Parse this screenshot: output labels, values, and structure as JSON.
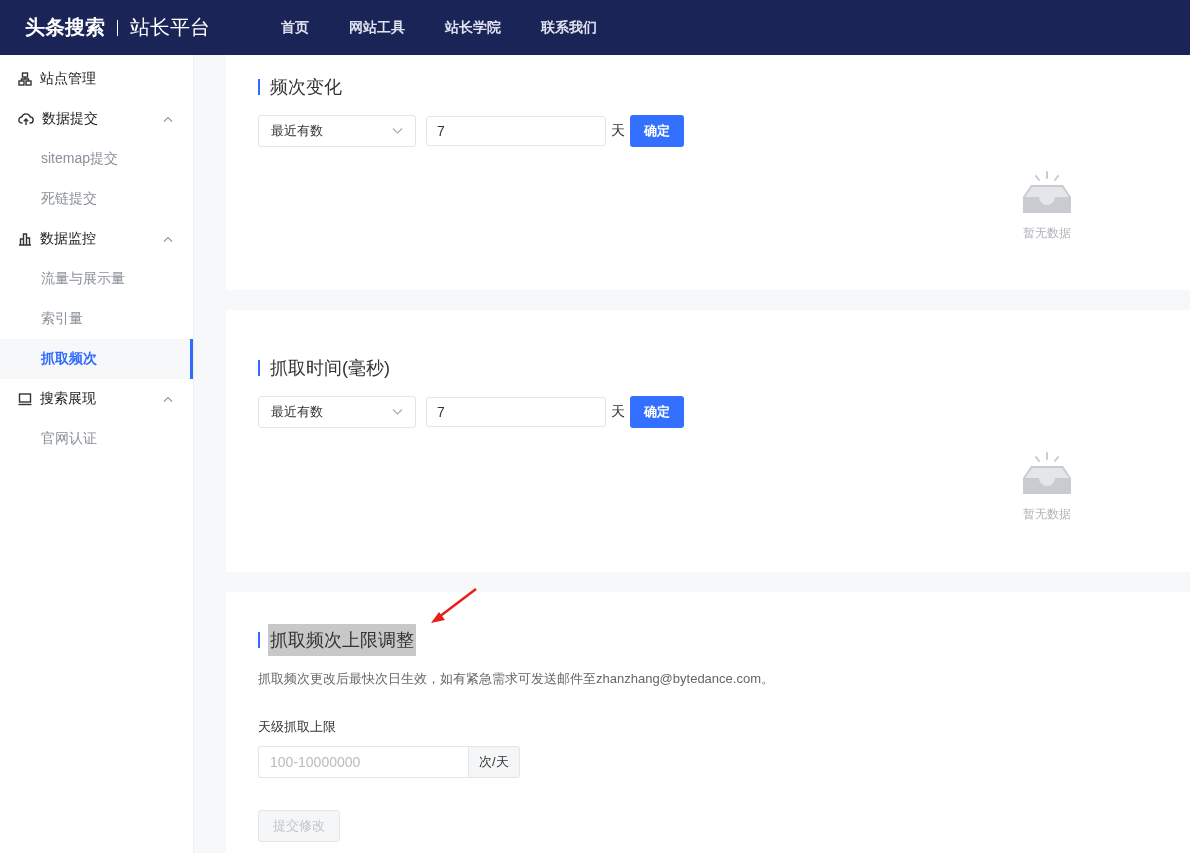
{
  "header": {
    "brand": "头条搜索",
    "product": "站长平台",
    "nav": [
      {
        "label": "首页"
      },
      {
        "label": "网站工具"
      },
      {
        "label": "站长学院"
      },
      {
        "label": "联系我们"
      }
    ]
  },
  "sidebar": {
    "items": [
      {
        "label": "站点管理"
      },
      {
        "label": "数据提交",
        "expanded": true,
        "children": [
          {
            "label": "sitemap提交",
            "selected": false
          },
          {
            "label": "死链提交",
            "selected": false
          }
        ]
      },
      {
        "label": "数据监控",
        "expanded": true,
        "children": [
          {
            "label": "流量与展示量",
            "selected": false
          },
          {
            "label": "索引量",
            "selected": false
          },
          {
            "label": "抓取频次",
            "selected": true
          }
        ]
      },
      {
        "label": "搜索展现",
        "expanded": true,
        "children": [
          {
            "label": "官网认证",
            "selected": false
          }
        ]
      }
    ]
  },
  "cards": [
    {
      "kind": "filter",
      "title": "频次变化",
      "select": "最近有数",
      "days": "7",
      "unit": "天",
      "button": "确定",
      "empty": "暂无数据"
    },
    {
      "kind": "filter",
      "title": "抓取时间(毫秒)",
      "select": "最近有数",
      "days": "7",
      "unit": "天",
      "button": "确定",
      "empty": "暂无数据"
    },
    {
      "kind": "limit",
      "title": "抓取频次上限调整",
      "highlighted": true,
      "note": "抓取频次更改后最快次日生效，如有紧急需求可发送邮件至zhanzhang@bytedance.com。",
      "field_label": "天级抓取上限",
      "placeholder": "100-10000000",
      "addon": "次/天",
      "submit": "提交修改",
      "submit_disabled": true
    }
  ]
}
